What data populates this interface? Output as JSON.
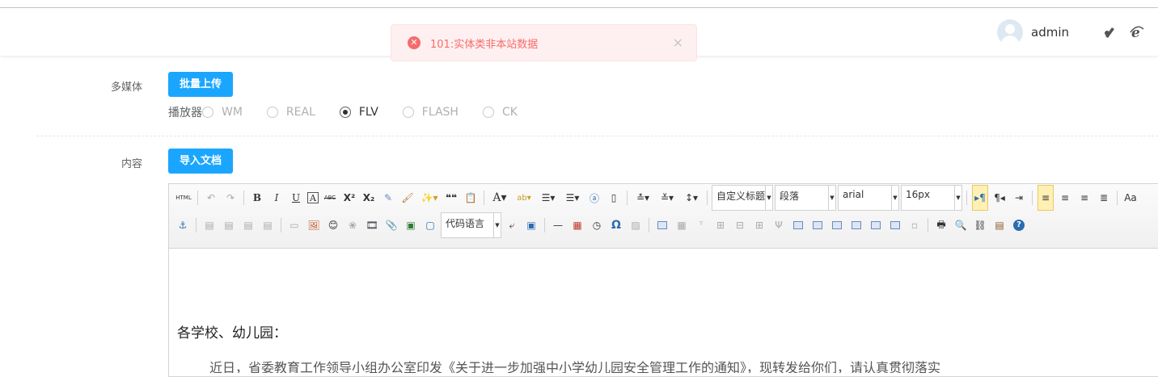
{
  "header": {
    "username": "admin"
  },
  "toast": {
    "message": "101:实体类非本站数据",
    "close": "×"
  },
  "media": {
    "label": "多媒体",
    "upload_button": "批量上传",
    "player_label": "播放器",
    "players": [
      {
        "label": "WM",
        "selected": false
      },
      {
        "label": "REAL",
        "selected": false
      },
      {
        "label": "FLV",
        "selected": true
      },
      {
        "label": "FLASH",
        "selected": false
      },
      {
        "label": "CK",
        "selected": false
      }
    ]
  },
  "content": {
    "label": "内容",
    "import_button": "导入文档",
    "toolbar": {
      "html_label": "HTML",
      "bold": "B",
      "italic": "I",
      "underline": "U",
      "frame": "A",
      "strike": "ABC",
      "superscript": "X²",
      "subscript": "X₂",
      "quote": "❝❝",
      "fontcolor": "A",
      "custom_title": "自定义标题",
      "paragraph": "段落",
      "font_family": "arial",
      "font_size": "16px",
      "code_language": "代码语言",
      "omega": "Ω",
      "help": "?"
    },
    "body_line1": "各学校、幼儿园：",
    "body_line2": "近日，省委教育工作领导小组办公室印发《关于进一步加强中小学幼儿园安全管理工作的通知》，现转发给你们，请认真贯彻落实"
  }
}
